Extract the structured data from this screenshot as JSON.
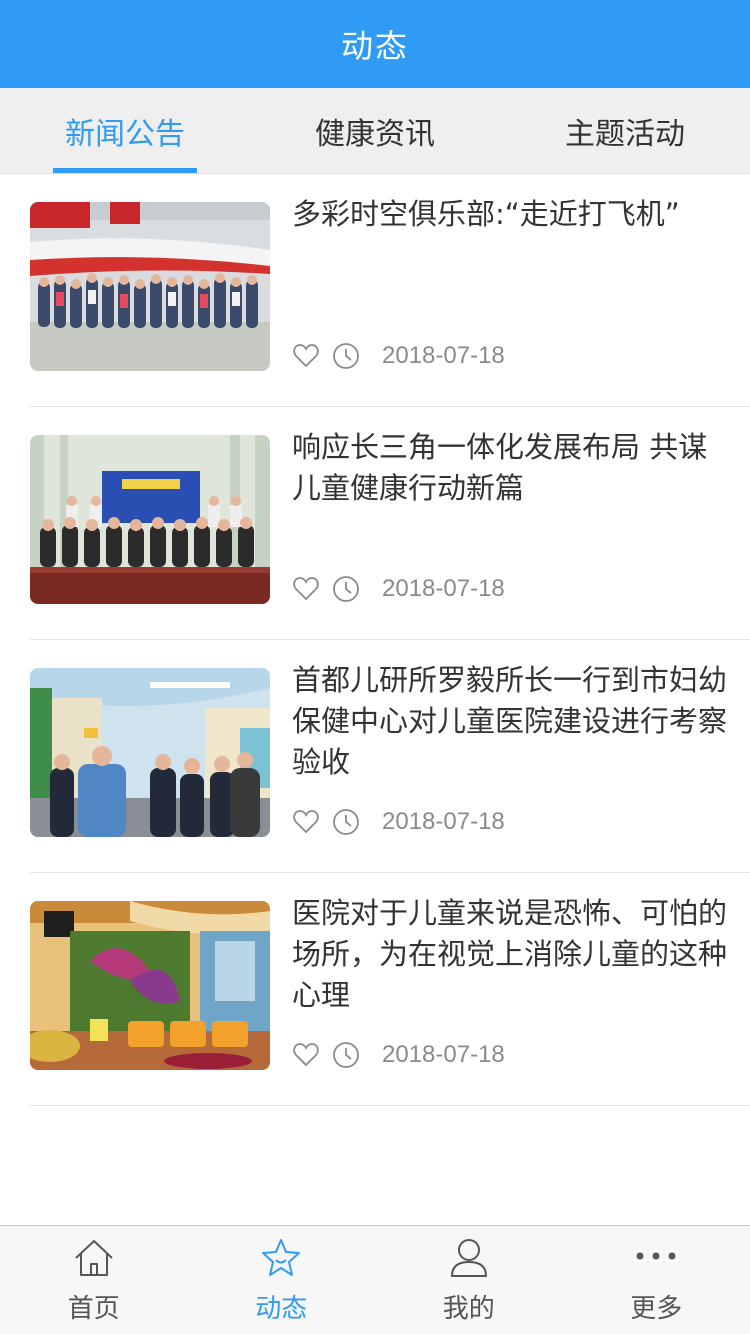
{
  "header": {
    "title": "动态"
  },
  "tabs": [
    {
      "label": "新闻公告",
      "active": true
    },
    {
      "label": "健康资讯",
      "active": false
    },
    {
      "label": "主题活动",
      "active": false
    }
  ],
  "news": [
    {
      "title": "多彩时空俱乐部:“走近打飞机”",
      "date": "2018-07-18",
      "icon_like": "heart-icon",
      "icon_time": "clock-icon",
      "image": "group-photo-aircraft-hangar"
    },
    {
      "title": "响应长三角一体化发展布局 共谋儿童健康行动新篇",
      "date": "2018-07-18",
      "icon_like": "heart-icon",
      "icon_time": "clock-icon",
      "image": "conference-group-photo"
    },
    {
      "title": "首都儿研所罗毅所长一行到市妇幼保健中心对儿童医院建设进行考察验收",
      "date": "2018-07-18",
      "icon_like": "heart-icon",
      "icon_time": "clock-icon",
      "image": "hospital-inspection-visit"
    },
    {
      "title": "医院对于儿童来说是恐怖、可怕的场所，为在视觉上消除儿童的这种心理",
      "date": "2018-07-18",
      "icon_like": "heart-icon",
      "icon_time": "clock-icon",
      "image": "colorful-hospital-lobby"
    }
  ],
  "tabbar": [
    {
      "label": "首页",
      "icon": "home-icon",
      "active": false
    },
    {
      "label": "动态",
      "icon": "star-icon",
      "active": true
    },
    {
      "label": "我的",
      "icon": "user-icon",
      "active": false
    },
    {
      "label": "更多",
      "icon": "more-icon",
      "active": false
    }
  ],
  "colors": {
    "primary": "#2f9bf4",
    "tab_bg": "#efefef",
    "text": "#333333",
    "meta": "#8a8a8a"
  }
}
